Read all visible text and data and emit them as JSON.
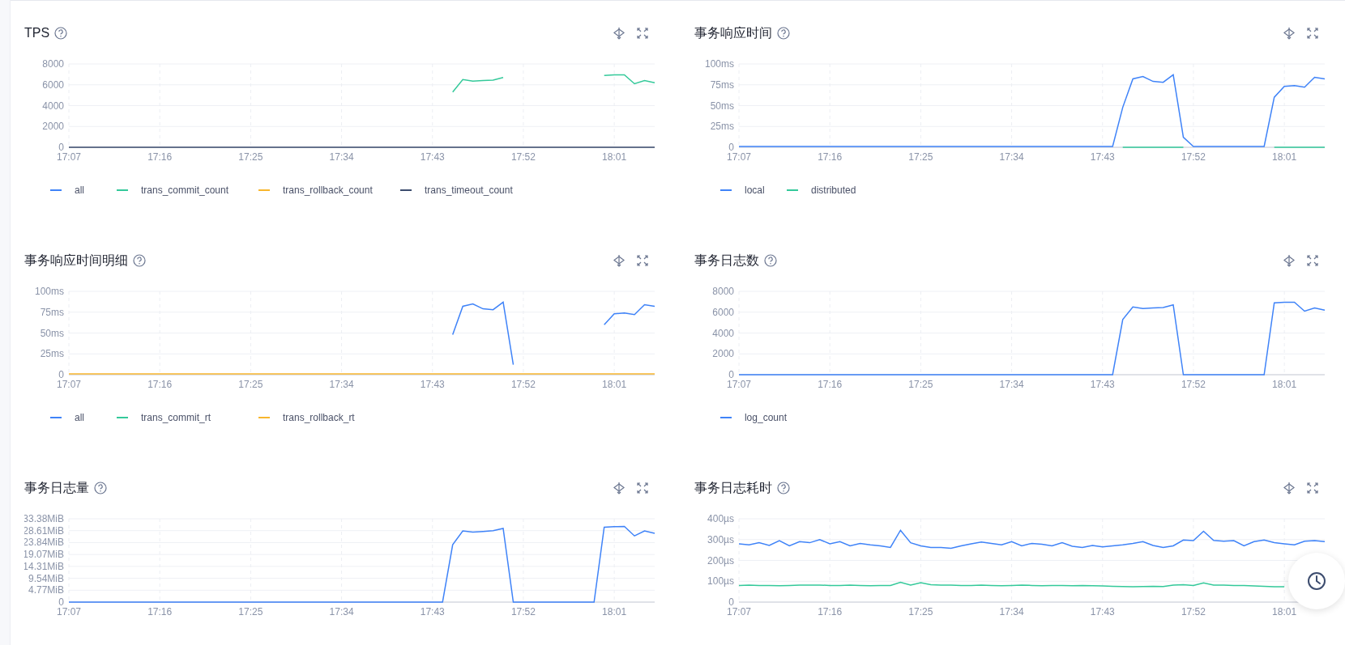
{
  "charts": [
    {
      "title": "TPS",
      "chart_data": {
        "type": "line",
        "grid": true,
        "ylim": [
          0,
          8000
        ],
        "yticks": [
          0,
          2000,
          4000,
          6000,
          8000
        ],
        "categories": [
          "17:07",
          null,
          null,
          null,
          null,
          null,
          null,
          null,
          null,
          "17:16",
          null,
          null,
          null,
          null,
          null,
          null,
          null,
          null,
          "17:25",
          null,
          null,
          null,
          null,
          null,
          null,
          null,
          null,
          "17:34",
          null,
          null,
          null,
          null,
          null,
          null,
          null,
          null,
          "17:43",
          null,
          null,
          null,
          null,
          null,
          null,
          null,
          null,
          "17:52",
          null,
          null,
          null,
          null,
          null,
          null,
          null,
          null,
          "18:01",
          null,
          null,
          null,
          null
        ],
        "series": [
          {
            "name": "all",
            "color": "#3f83f8",
            "values": [
              null,
              null,
              null,
              null,
              null,
              null,
              null,
              null,
              null,
              null,
              null,
              null,
              null,
              null,
              null,
              null,
              null,
              null,
              null,
              null,
              null,
              null,
              null,
              null,
              null,
              null,
              null,
              null,
              null,
              null,
              null,
              null,
              null,
              null,
              null,
              null,
              null,
              null,
              null,
              null,
              null,
              null,
              null,
              null,
              null,
              null,
              null,
              null,
              null,
              null,
              null,
              null,
              null,
              null,
              null,
              null,
              null,
              null,
              null
            ]
          },
          {
            "name": "trans_commit_count",
            "color": "#34c99a",
            "values": [
              null,
              null,
              null,
              null,
              null,
              null,
              null,
              null,
              null,
              null,
              null,
              null,
              null,
              null,
              null,
              null,
              null,
              null,
              null,
              null,
              null,
              null,
              null,
              null,
              null,
              null,
              null,
              null,
              null,
              null,
              null,
              null,
              null,
              null,
              null,
              null,
              null,
              null,
              5300,
              6500,
              6350,
              6400,
              6450,
              6700,
              null,
              null,
              null,
              null,
              null,
              null,
              null,
              null,
              null,
              6900,
              6950,
              6950,
              6100,
              6400,
              6200
            ]
          },
          {
            "name": "trans_rollback_count",
            "color": "#f8b62d",
            "values": [
              null,
              null,
              null,
              null,
              null,
              null,
              null,
              null,
              null,
              null,
              null,
              null,
              null,
              null,
              null,
              null,
              null,
              null,
              null,
              null,
              null,
              null,
              null,
              null,
              null,
              null,
              null,
              null,
              null,
              null,
              null,
              null,
              null,
              null,
              null,
              null,
              null,
              null,
              null,
              null,
              null,
              null,
              null,
              null,
              null,
              null,
              null,
              null,
              null,
              null,
              null,
              null,
              null,
              null,
              null,
              null,
              null,
              null,
              null
            ]
          },
          {
            "name": "trans_timeout_count",
            "color": "#3c4c6e",
            "values": [
              0,
              0,
              0,
              0,
              0,
              0,
              0,
              0,
              0,
              0,
              0,
              0,
              0,
              0,
              0,
              0,
              0,
              0,
              0,
              0,
              0,
              0,
              0,
              0,
              0,
              0,
              0,
              0,
              0,
              0,
              0,
              0,
              0,
              0,
              0,
              0,
              0,
              0,
              0,
              0,
              0,
              0,
              0,
              0,
              0,
              0,
              0,
              0,
              0,
              0,
              0,
              0,
              0,
              0,
              0,
              0,
              0,
              0,
              0
            ]
          }
        ]
      }
    },
    {
      "title": "事务响应时间",
      "chart_data": {
        "type": "line",
        "grid": true,
        "ylim": [
          0,
          100
        ],
        "yticks": [
          0,
          {
            "value": 25,
            "label": "25ms"
          },
          {
            "value": 50,
            "label": "50ms"
          },
          {
            "value": 75,
            "label": "75ms"
          },
          {
            "value": 100,
            "label": "100ms"
          }
        ],
        "categories": [
          "17:07",
          null,
          null,
          null,
          null,
          null,
          null,
          null,
          null,
          "17:16",
          null,
          null,
          null,
          null,
          null,
          null,
          null,
          null,
          "17:25",
          null,
          null,
          null,
          null,
          null,
          null,
          null,
          null,
          "17:34",
          null,
          null,
          null,
          null,
          null,
          null,
          null,
          null,
          "17:43",
          null,
          null,
          null,
          null,
          null,
          null,
          null,
          null,
          "17:52",
          null,
          null,
          null,
          null,
          null,
          null,
          null,
          null,
          "18:01",
          null,
          null,
          null,
          null
        ],
        "series": [
          {
            "name": "local",
            "color": "#3f83f8",
            "values": [
              1,
              1,
              1,
              1,
              1,
              1,
              1,
              1,
              1,
              1,
              1,
              1,
              1,
              1,
              1,
              1,
              1,
              1,
              1,
              1,
              1,
              1,
              1,
              1,
              1,
              1,
              1,
              1,
              1,
              1,
              1,
              1,
              1,
              1,
              1,
              1,
              1,
              1,
              48,
              82,
              85,
              79,
              78,
              87,
              12,
              1,
              1,
              1,
              1,
              1,
              1,
              1,
              1,
              60,
              73,
              74,
              72,
              84,
              82
            ]
          },
          {
            "name": "distributed",
            "color": "#34c99a",
            "values": [
              null,
              null,
              null,
              null,
              null,
              null,
              null,
              null,
              null,
              null,
              null,
              null,
              null,
              null,
              null,
              null,
              null,
              null,
              null,
              null,
              null,
              null,
              null,
              null,
              null,
              null,
              null,
              null,
              null,
              null,
              null,
              null,
              null,
              null,
              null,
              null,
              null,
              null,
              0,
              0,
              0,
              0,
              0,
              0,
              0,
              null,
              null,
              null,
              null,
              null,
              null,
              null,
              null,
              0,
              0,
              0,
              0,
              0,
              0
            ]
          }
        ]
      }
    },
    {
      "title": "事务响应时间明细",
      "chart_data": {
        "type": "line",
        "grid": true,
        "ylim": [
          0,
          100
        ],
        "yticks": [
          0,
          {
            "value": 25,
            "label": "25ms"
          },
          {
            "value": 50,
            "label": "50ms"
          },
          {
            "value": 75,
            "label": "75ms"
          },
          {
            "value": 100,
            "label": "100ms"
          }
        ],
        "categories": [
          "17:07",
          null,
          null,
          null,
          null,
          null,
          null,
          null,
          null,
          "17:16",
          null,
          null,
          null,
          null,
          null,
          null,
          null,
          null,
          "17:25",
          null,
          null,
          null,
          null,
          null,
          null,
          null,
          null,
          "17:34",
          null,
          null,
          null,
          null,
          null,
          null,
          null,
          null,
          "17:43",
          null,
          null,
          null,
          null,
          null,
          null,
          null,
          null,
          "17:52",
          null,
          null,
          null,
          null,
          null,
          null,
          null,
          null,
          "18:01",
          null,
          null,
          null,
          null
        ],
        "series": [
          {
            "name": "all",
            "color": "#3f83f8",
            "values": [
              null,
              null,
              null,
              null,
              null,
              null,
              null,
              null,
              null,
              null,
              null,
              null,
              null,
              null,
              null,
              null,
              null,
              null,
              null,
              null,
              null,
              null,
              null,
              null,
              null,
              null,
              null,
              null,
              null,
              null,
              null,
              null,
              null,
              null,
              null,
              null,
              null,
              null,
              48,
              82,
              85,
              79,
              78,
              87,
              12,
              null,
              null,
              null,
              null,
              null,
              null,
              null,
              null,
              60,
              73,
              74,
              72,
              84,
              82
            ]
          },
          {
            "name": "trans_commit_rt",
            "color": "#34c99a",
            "values": [
              null,
              null,
              null,
              null,
              null,
              null,
              null,
              null,
              null,
              null,
              null,
              null,
              null,
              null,
              null,
              null,
              null,
              null,
              null,
              null,
              null,
              null,
              null,
              null,
              null,
              null,
              null,
              null,
              null,
              null,
              null,
              null,
              null,
              null,
              null,
              null,
              null,
              null,
              null,
              null,
              null,
              null,
              null,
              null,
              null,
              null,
              null,
              null,
              null,
              null,
              null,
              null,
              null,
              null,
              null,
              null,
              null,
              null,
              null
            ]
          },
          {
            "name": "trans_rollback_rt",
            "color": "#f8b62d",
            "values": [
              1,
              1,
              1,
              1,
              1,
              1,
              1,
              1,
              1,
              1,
              1,
              1,
              1,
              1,
              1,
              1,
              1,
              1,
              1,
              1,
              1,
              1,
              1,
              1,
              1,
              1,
              1,
              1,
              1,
              1,
              1,
              1,
              1,
              1,
              1,
              1,
              1,
              1,
              1,
              1,
              1,
              1,
              1,
              1,
              1,
              1,
              1,
              1,
              1,
              1,
              1,
              1,
              1,
              1,
              1,
              1,
              1,
              1,
              1
            ]
          }
        ]
      }
    },
    {
      "title": "事务日志数",
      "chart_data": {
        "type": "line",
        "grid": true,
        "ylim": [
          0,
          8000
        ],
        "yticks": [
          0,
          2000,
          4000,
          6000,
          8000
        ],
        "categories": [
          "17:07",
          null,
          null,
          null,
          null,
          null,
          null,
          null,
          null,
          "17:16",
          null,
          null,
          null,
          null,
          null,
          null,
          null,
          null,
          "17:25",
          null,
          null,
          null,
          null,
          null,
          null,
          null,
          null,
          "17:34",
          null,
          null,
          null,
          null,
          null,
          null,
          null,
          null,
          "17:43",
          null,
          null,
          null,
          null,
          null,
          null,
          null,
          null,
          "17:52",
          null,
          null,
          null,
          null,
          null,
          null,
          null,
          null,
          "18:01",
          null,
          null,
          null,
          null
        ],
        "series": [
          {
            "name": "log_count",
            "color": "#3f83f8",
            "values": [
              0,
              0,
              0,
              0,
              0,
              0,
              0,
              0,
              0,
              0,
              0,
              0,
              0,
              0,
              0,
              0,
              0,
              0,
              0,
              0,
              0,
              0,
              0,
              0,
              0,
              0,
              0,
              0,
              0,
              0,
              0,
              0,
              0,
              0,
              0,
              0,
              0,
              0,
              5300,
              6500,
              6350,
              6400,
              6450,
              6700,
              0,
              0,
              0,
              0,
              0,
              0,
              0,
              0,
              0,
              6900,
              6950,
              6950,
              6100,
              6400,
              6200
            ]
          }
        ]
      }
    },
    {
      "title": "事务日志量",
      "chart_data": {
        "type": "line",
        "grid": true,
        "ylim": [
          0,
          33.38
        ],
        "yticks": [
          0,
          {
            "value": 4.77,
            "label": "4.77MiB"
          },
          {
            "value": 9.54,
            "label": "9.54MiB"
          },
          {
            "value": 14.31,
            "label": "14.31MiB"
          },
          {
            "value": 19.07,
            "label": "19.07MiB"
          },
          {
            "value": 23.84,
            "label": "23.84MiB"
          },
          {
            "value": 28.61,
            "label": "28.61MiB"
          },
          {
            "value": 33.38,
            "label": "33.38MiB"
          }
        ],
        "categories": [
          "17:07",
          null,
          null,
          null,
          null,
          null,
          null,
          null,
          null,
          "17:16",
          null,
          null,
          null,
          null,
          null,
          null,
          null,
          null,
          "17:25",
          null,
          null,
          null,
          null,
          null,
          null,
          null,
          null,
          "17:34",
          null,
          null,
          null,
          null,
          null,
          null,
          null,
          null,
          "17:43",
          null,
          null,
          null,
          null,
          null,
          null,
          null,
          null,
          "17:52",
          null,
          null,
          null,
          null,
          null,
          null,
          null,
          null,
          "18:01",
          null,
          null,
          null,
          null
        ],
        "series": [
          {
            "color": "#3f83f8",
            "values": [
              0,
              0,
              0,
              0,
              0,
              0,
              0,
              0,
              0,
              0,
              0,
              0,
              0,
              0,
              0,
              0,
              0,
              0,
              0,
              0,
              0,
              0,
              0,
              0,
              0,
              0,
              0,
              0,
              0,
              0,
              0,
              0,
              0,
              0,
              0,
              0,
              0,
              0,
              23,
              28.5,
              28,
              28.3,
              28.6,
              29.5,
              0,
              0,
              0,
              0,
              0,
              0,
              0,
              0,
              0,
              30,
              30.2,
              30.3,
              26.5,
              28.5,
              27.5
            ]
          }
        ]
      }
    },
    {
      "title": "事务日志耗时",
      "chart_data": {
        "type": "line",
        "grid": true,
        "ylim": [
          0,
          400
        ],
        "yticks": [
          0,
          {
            "value": 100,
            "label": "100µs"
          },
          {
            "value": 200,
            "label": "200µs"
          },
          {
            "value": 300,
            "label": "300µs"
          },
          {
            "value": 400,
            "label": "400µs"
          }
        ],
        "categories": [
          "17:07",
          null,
          null,
          null,
          null,
          null,
          null,
          null,
          null,
          "17:16",
          null,
          null,
          null,
          null,
          null,
          null,
          null,
          null,
          "17:25",
          null,
          null,
          null,
          null,
          null,
          null,
          null,
          null,
          "17:34",
          null,
          null,
          null,
          null,
          null,
          null,
          null,
          null,
          "17:43",
          null,
          null,
          null,
          null,
          null,
          null,
          null,
          null,
          "17:52",
          null,
          null,
          null,
          null,
          null,
          null,
          null,
          null,
          "18:01",
          null,
          null,
          null,
          null
        ],
        "series": [
          {
            "color": "#3f83f8",
            "values": [
              280,
              275,
              285,
              272,
              295,
              270,
              290,
              285,
              300,
              280,
              290,
              270,
              282,
              275,
              270,
              262,
              345,
              285,
              270,
              262,
              262,
              258,
              270,
              280,
              288,
              282,
              275,
              290,
              270,
              282,
              278,
              270,
              285,
              268,
              262,
              272,
              265,
              270,
              275,
              282,
              290,
              272,
              262,
              270,
              298,
              295,
              340,
              296,
              292,
              295,
              270,
              290,
              298,
              285,
              280,
              275,
              292,
              295,
              290
            ]
          },
          {
            "color": "#34c99a",
            "values": [
              80,
              81,
              80,
              80,
              79,
              80,
              82,
              81,
              82,
              80,
              80,
              81,
              80,
              79,
              80,
              80,
              95,
              82,
              93,
              84,
              82,
              81,
              80,
              80,
              81,
              80,
              79,
              80,
              81,
              80,
              79,
              80,
              80,
              79,
              80,
              79,
              78,
              76,
              75,
              74,
              75,
              76,
              75,
              82,
              84,
              80,
              92,
              82,
              81,
              80,
              80,
              78,
              76,
              74,
              74,
              null,
              null,
              null,
              null
            ]
          }
        ]
      }
    }
  ]
}
